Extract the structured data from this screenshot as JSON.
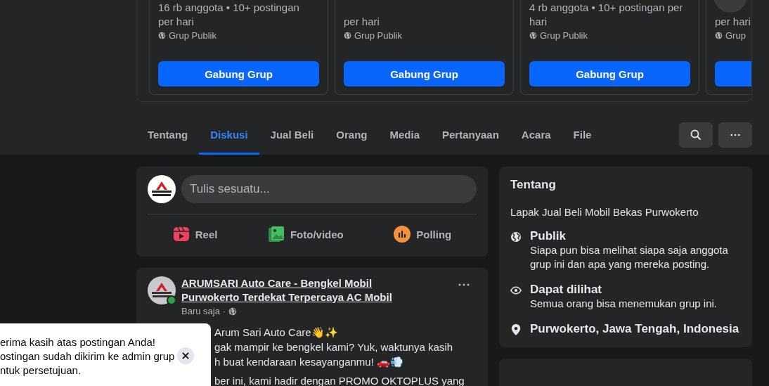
{
  "suggested_groups": [
    {
      "meta": [
        "16 rb anggota • 10+ postingan",
        "per hari"
      ],
      "privacy": "Grup Publik",
      "button": "Gabung Grup"
    },
    {
      "meta": [
        "per hari"
      ],
      "privacy": "Grup Publik",
      "button": "Gabung Grup"
    },
    {
      "meta": [
        "4 rb anggota • 10+ postingan per",
        "hari"
      ],
      "privacy": "Grup Publik",
      "button": "Gabung Grup"
    },
    {
      "meta": [
        "per hari"
      ],
      "privacy": "Grup"
    }
  ],
  "tabs": [
    {
      "label": "Tentang",
      "selected": false
    },
    {
      "label": "Diskusi",
      "selected": true
    },
    {
      "label": "Jual Beli",
      "selected": false
    },
    {
      "label": "Orang",
      "selected": false
    },
    {
      "label": "Media",
      "selected": false
    },
    {
      "label": "Pertanyaan",
      "selected": false
    },
    {
      "label": "Acara",
      "selected": false
    },
    {
      "label": "File",
      "selected": false
    }
  ],
  "composer": {
    "placeholder": "Tulis sesuatu...",
    "actions": [
      {
        "kind": "reel",
        "label": "Reel"
      },
      {
        "kind": "photo",
        "label": "Foto/video"
      },
      {
        "kind": "poll",
        "label": "Polling"
      }
    ]
  },
  "post": {
    "author": "ARUMSARI Auto Care - Bengkel Mobil Purwokerto Terdekat Terpercaya AC Mobil",
    "online": true,
    "time": "Baru saja ·",
    "paragraphs": [
      [
        "Arum Sari Auto Care👋✨",
        "gak mampir ke bengkel kami? Yuk, waktunya kasih",
        "h buat kendaraan kesayanganmu! 🚗💨"
      ],
      [
        "ber ini, kami hadir dengan PROMO OKTOPLUS yang"
      ]
    ]
  },
  "about": {
    "title": "Tentang",
    "description": "Lapak Jual Beli Mobil Bekas Purwokerto",
    "items": [
      {
        "kind": "public",
        "title": "Publik",
        "text": "Siapa pun bisa melihat siapa saja anggota grup ini dan apa yang mereka posting."
      },
      {
        "kind": "visible",
        "title": "Dapat dilihat",
        "text": "Semua orang bisa menemukan grup ini."
      },
      {
        "kind": "location",
        "title": "Purwokerto, Jawa Tengah, Indonesia"
      }
    ]
  },
  "toast": {
    "text": "erima kasih atas postingan Anda!\nostingan sudah dikirim ke admin grup\nntuk persetujuan."
  }
}
